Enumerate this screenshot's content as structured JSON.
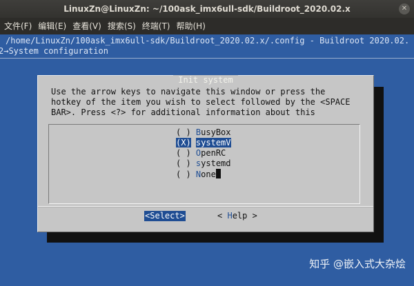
{
  "window": {
    "title": "LinuxZn@LinuxZn: ~/100ask_imx6ull-sdk/Buildroot_2020.02.x"
  },
  "menu": [
    {
      "label": "文件(F)"
    },
    {
      "label": "编辑(E)"
    },
    {
      "label": "查看(V)"
    },
    {
      "label": "搜索(S)"
    },
    {
      "label": "终端(T)"
    },
    {
      "label": "帮助(H)"
    }
  ],
  "terminal": {
    "path_line": "/home/LinuxZn/100ask_imx6ull-sdk/Buildroot_2020.02.x/.config - Buildroot 2020.02.",
    "breadcrumb": "2→System configuration"
  },
  "dialog": {
    "title": "Init system",
    "help_lines": [
      "Use the arrow keys to navigate this window or press the",
      "hotkey of the item you wish to select followed by the <SPACE",
      "BAR>. Press <?> for additional information about this"
    ],
    "options": [
      {
        "mark": "( )",
        "hotkey": "B",
        "rest": "usyBox",
        "selected": false
      },
      {
        "mark": "(X)",
        "hotkey": "s",
        "rest": "ystemV",
        "selected": true
      },
      {
        "mark": "( )",
        "hotkey": "O",
        "rest": "penRC",
        "selected": false
      },
      {
        "mark": "( )",
        "hotkey": "s",
        "rest": "ystemd",
        "selected": false
      },
      {
        "mark": "( )",
        "hotkey": "N",
        "rest": "one",
        "selected": false
      }
    ],
    "buttons": {
      "select": {
        "open": "<",
        "hotkey": "S",
        "rest": "elect",
        "close": ">"
      },
      "help": {
        "open": "< ",
        "hotkey": "H",
        "rest": "elp",
        "close": " >"
      }
    }
  },
  "watermark": {
    "text": "知乎 @嵌入式大杂烩"
  },
  "colors": {
    "terminal_bg": "#2f5da2",
    "dialog_bg": "#c6c6c6",
    "highlight": "#1f4d93"
  }
}
